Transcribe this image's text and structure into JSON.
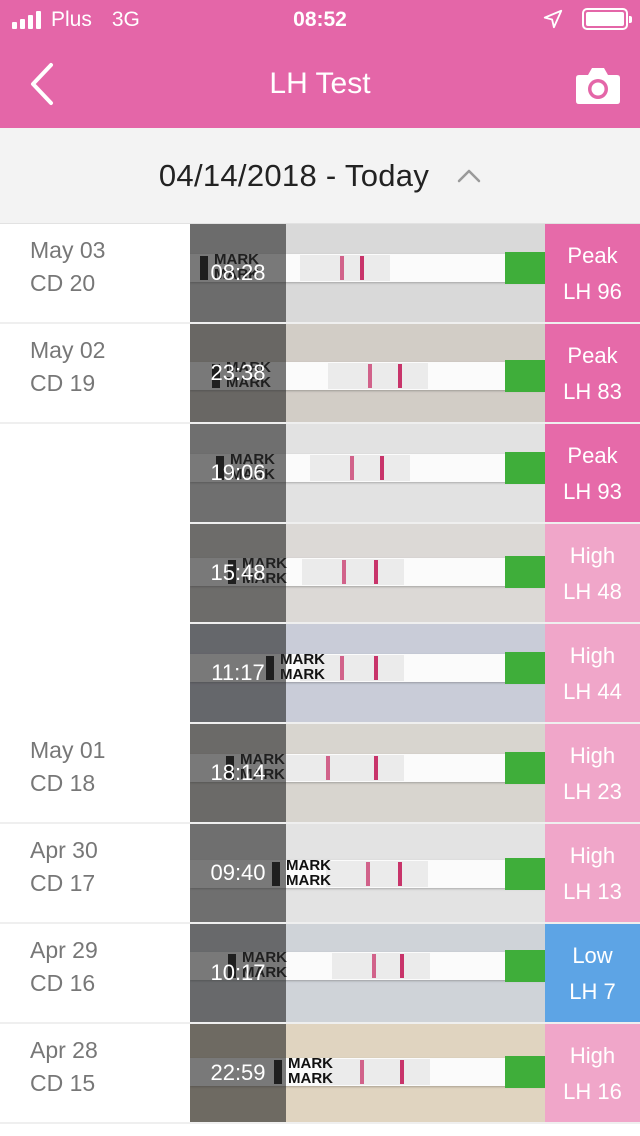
{
  "status_bar": {
    "carrier": "Plus",
    "network": "3G",
    "time": "08:52"
  },
  "nav": {
    "title": "LH Test",
    "back_icon": "chevron-left-icon",
    "camera_icon": "camera-icon"
  },
  "date_header": {
    "range": "04/14/2018 - Today",
    "toggle_icon": "chevron-up-icon"
  },
  "colors": {
    "brand_pink": "#e466a8",
    "peak": "#e66aa9",
    "high": "#f0a6c9",
    "low": "#5da4e5"
  },
  "rows": [
    {
      "date": "May 03",
      "cycle_day": "CD 20",
      "time": "08:28",
      "level": "Peak",
      "lh": "LH 96",
      "status": "peak"
    },
    {
      "date": "May 02",
      "cycle_day": "CD 19",
      "time": "23:38",
      "level": "Peak",
      "lh": "LH 83",
      "status": "peak"
    },
    {
      "date": "",
      "cycle_day": "",
      "time": "19:06",
      "level": "Peak",
      "lh": "LH 93",
      "status": "peak"
    },
    {
      "date": "",
      "cycle_day": "",
      "time": "15:48",
      "level": "High",
      "lh": "LH 48",
      "status": "high"
    },
    {
      "date": "",
      "cycle_day": "",
      "time": "11:17",
      "level": "High",
      "lh": "LH 44",
      "status": "high"
    },
    {
      "date": "May 01",
      "cycle_day": "CD 18",
      "time": "18:14",
      "level": "High",
      "lh": "LH 23",
      "status": "high"
    },
    {
      "date": "Apr 30",
      "cycle_day": "CD 17",
      "time": "09:40",
      "level": "High",
      "lh": "LH 13",
      "status": "high"
    },
    {
      "date": "Apr 29",
      "cycle_day": "CD 16",
      "time": "10:17",
      "level": "Low",
      "lh": "LH 7",
      "status": "low"
    },
    {
      "date": "Apr 28",
      "cycle_day": "CD 15",
      "time": "22:59",
      "level": "High",
      "lh": "LH 16",
      "status": "high"
    }
  ],
  "strip": {
    "mark_text": "MARK"
  }
}
